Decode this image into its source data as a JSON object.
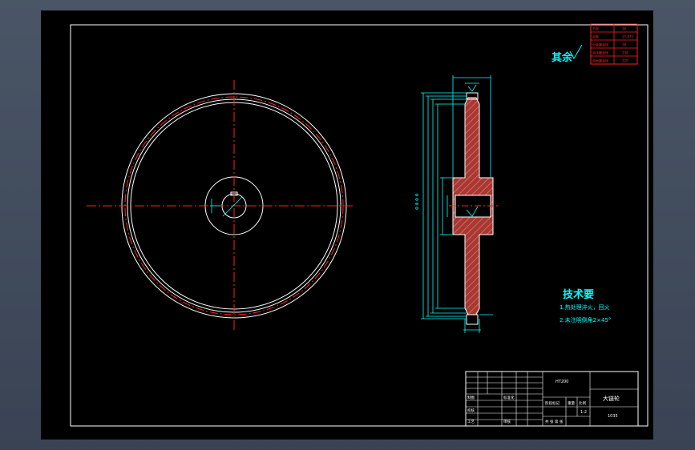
{
  "drawing": {
    "roughness_label": "其余",
    "tech_req_title": "技术要",
    "tech_req_line1": "1.热处理淬火，回火",
    "tech_req_line2": "2.未注明倒角2×45°",
    "part_name": "大链轮",
    "material": "HT200",
    "scale": "1:2",
    "title_cell_a": "制图",
    "title_cell_b": "校核",
    "title_cell_c": "审核",
    "title_cell_d": "工艺",
    "title_cell_e": "标准化",
    "title_cell_f": "阶段标记",
    "title_cell_g": "重量",
    "title_cell_h": "比例",
    "title_cell_i": "共 张 第 张",
    "params_rows": [
      "节距",
      "齿数",
      "分度圆直径",
      "齿顶圆直径",
      "齿根圆直径"
    ],
    "params_vals": [
      "16",
      "15.875",
      "38",
      "238",
      "220"
    ]
  },
  "colors": {
    "white": "#ffffff",
    "cyan": "#00ffff",
    "red": "#ff2020",
    "hatch": "#c0504d"
  }
}
